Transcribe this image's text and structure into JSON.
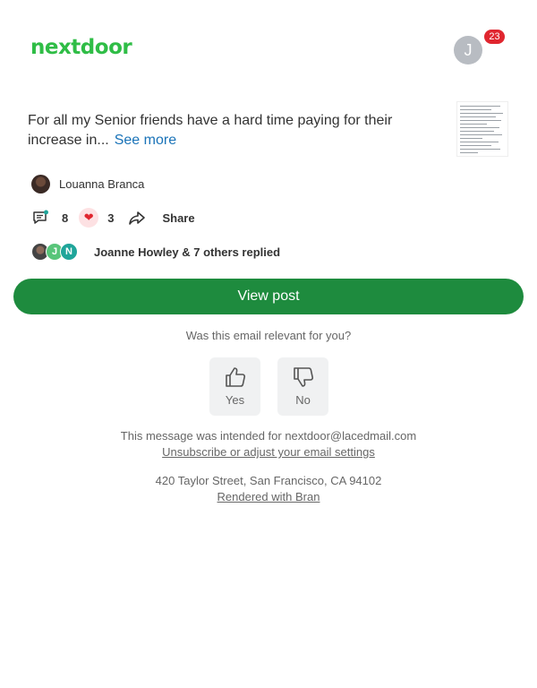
{
  "header": {
    "logo_text": "nextdoor",
    "avatar_initial": "J",
    "notification_count": "23",
    "brand_color": "#2fbd46"
  },
  "post": {
    "text": "For all my Senior friends have a hard time paying for their increase in...",
    "see_more_label": "See more",
    "author_name": "Louanna Branca",
    "comment_count": "8",
    "reaction_count": "3",
    "share_label": "Share",
    "reply_avatars": [
      "",
      "J",
      "N"
    ],
    "replies_text": "Joanne Howley & 7 others replied"
  },
  "cta": {
    "view_post_label": "View post",
    "button_color": "#1e8b3e"
  },
  "feedback": {
    "question": "Was this email relevant for you?",
    "yes_label": "Yes",
    "no_label": "No"
  },
  "footer": {
    "intended_text": "This message was intended for nextdoor@lacedmail.com",
    "unsubscribe_label": "Unsubscribe or adjust your email settings",
    "address": "420 Taylor Street, San Francisco, CA 94102",
    "rendered_label": "Rendered with Bran"
  },
  "icons": [
    "comment-icon",
    "heart-icon",
    "share-icon",
    "thumbs-up-icon",
    "thumbs-down-icon"
  ]
}
